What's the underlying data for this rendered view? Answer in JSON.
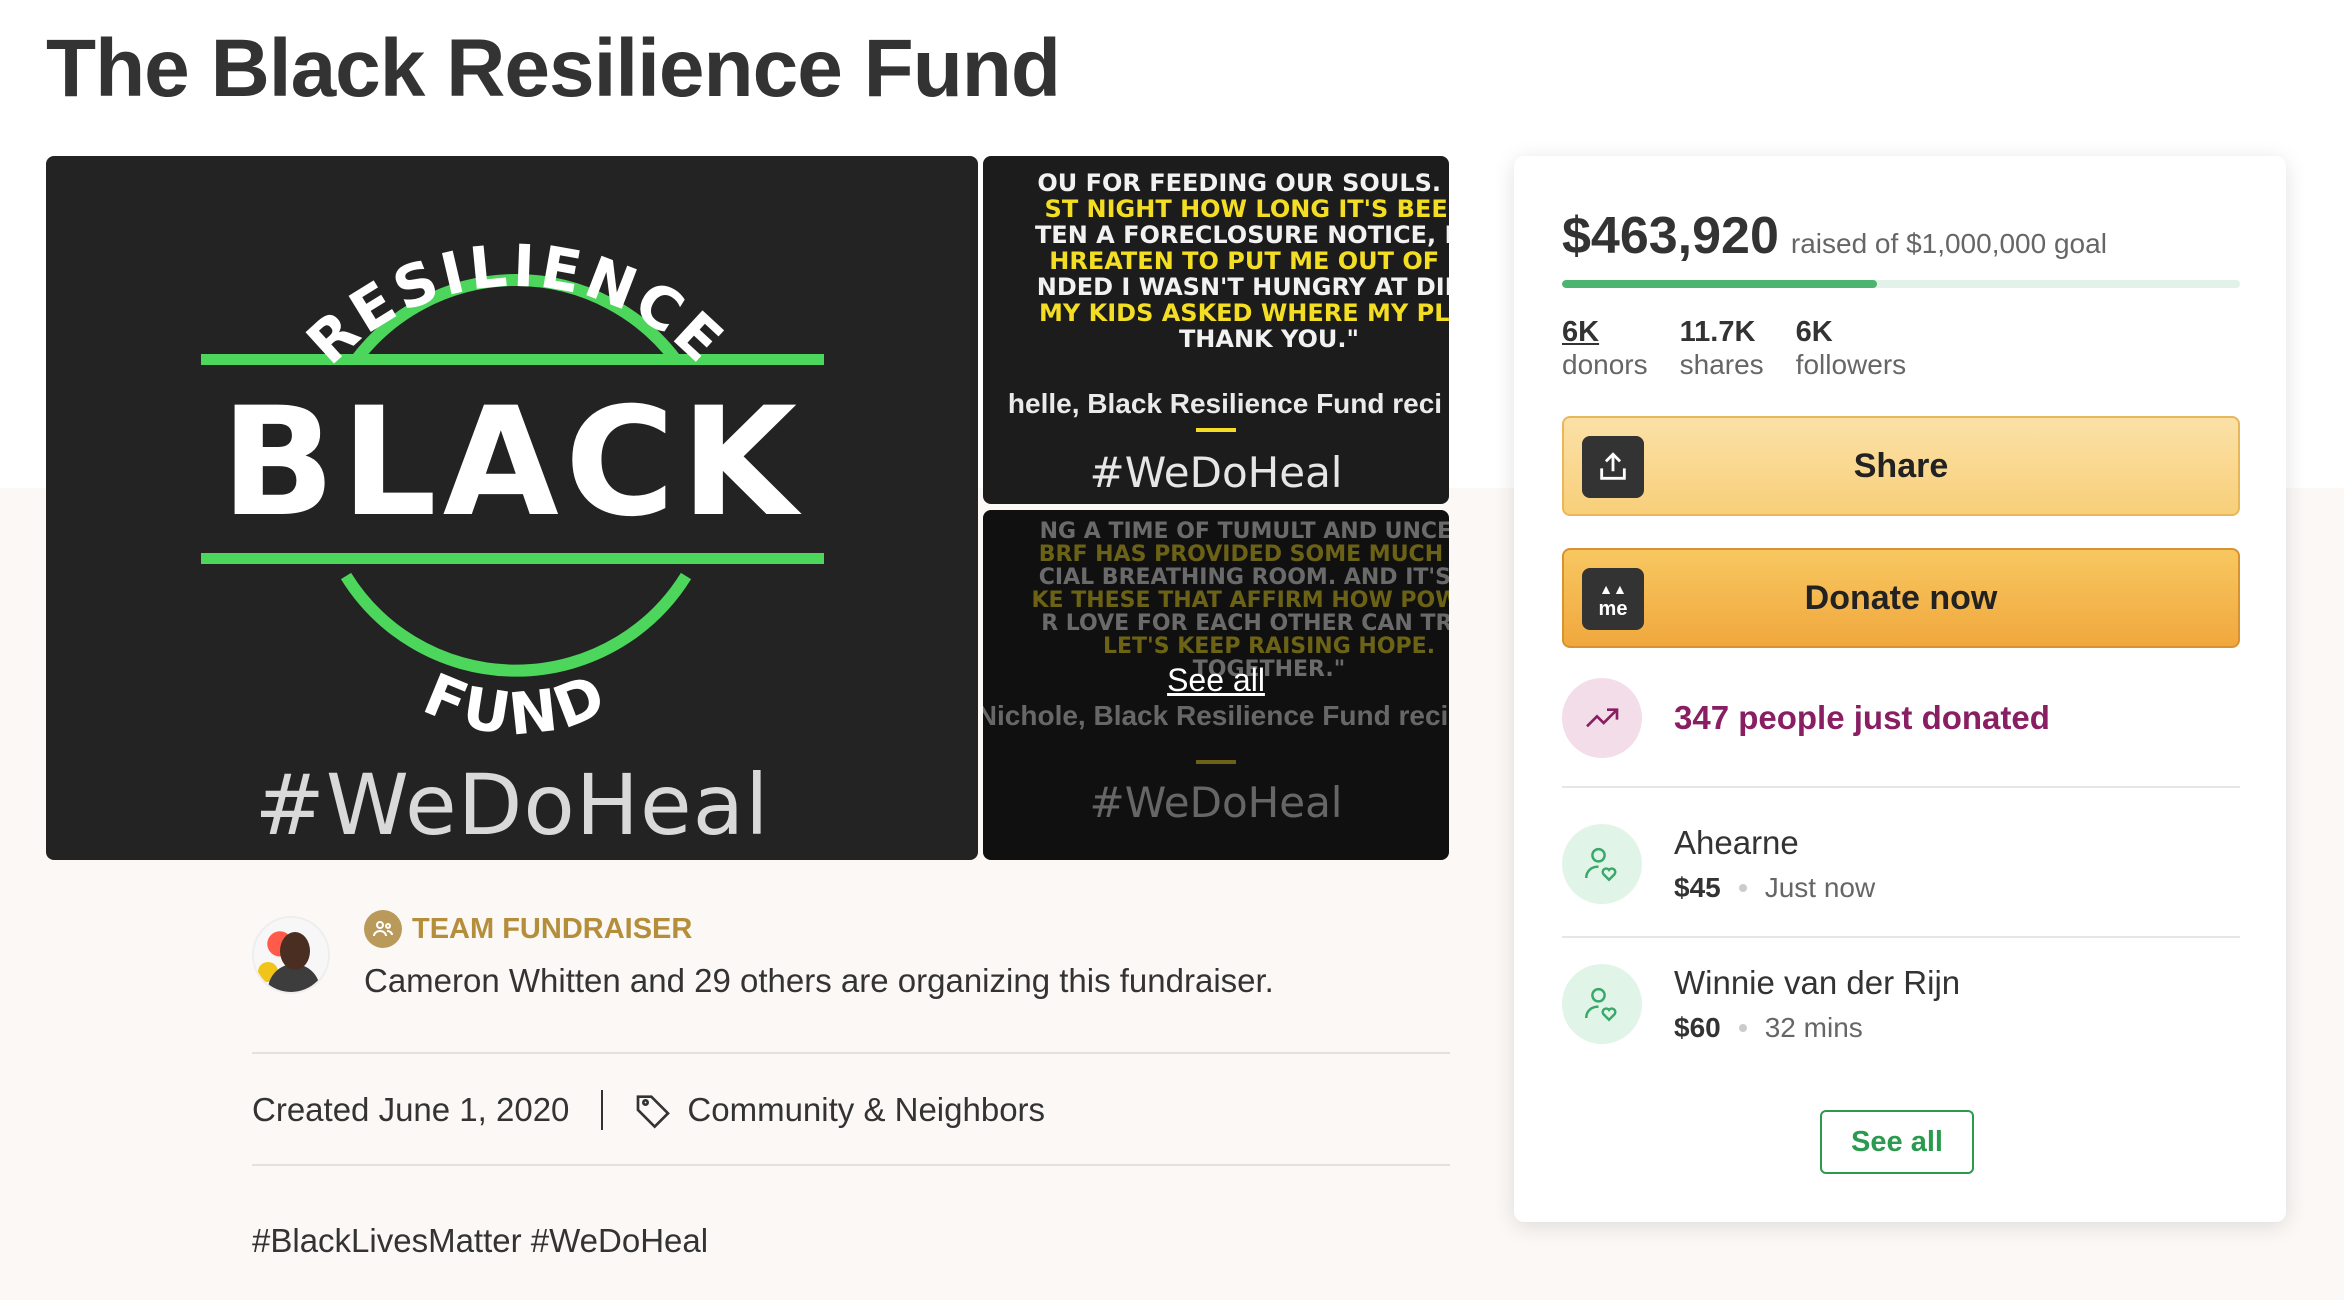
{
  "page": {
    "title": "The Black Resilience Fund"
  },
  "gallery": {
    "main_image": {
      "logo_top": "RESILIENCE",
      "logo_center": "BLACK",
      "logo_bottom": "FUND",
      "hashtag": "#WeDoHeal"
    },
    "thumb1": {
      "lines": [
        {
          "text": "OU FOR FEEDING OUR SOULS. IT C",
          "color": "white"
        },
        {
          "text": "ST NIGHT HOW LONG IT'S BEEN S",
          "color": "yellow"
        },
        {
          "text": "TEN A FORECLOSURE NOTICE, HAD",
          "color": "white"
        },
        {
          "text": "HREATEN TO PUT ME OUT OF MY",
          "color": "yellow"
        },
        {
          "text": "NDED I WASN'T HUNGRY AT DINNE",
          "color": "white"
        },
        {
          "text": "MY KIDS ASKED WHERE MY PLATE",
          "color": "yellow"
        },
        {
          "text": "THANK YOU.\"",
          "color": "white"
        }
      ],
      "attribution": "helle, Black Resilience Fund reci",
      "hashtag": "#WeDoHeal"
    },
    "thumb2": {
      "lines": [
        {
          "text": "NG A TIME OF TUMULT AND UNCERTA",
          "color": "white"
        },
        {
          "text": "BRF HAS PROVIDED SOME MUCH NEE",
          "color": "yellow"
        },
        {
          "text": "CIAL BREATHING ROOM. AND IT'S MO",
          "color": "white"
        },
        {
          "text": "KE THESE THAT AFFIRM HOW POWERF",
          "color": "yellow"
        },
        {
          "text": "R LOVE FOR EACH OTHER CAN TRULY",
          "color": "white"
        },
        {
          "text": "LET'S KEEP RAISING HOPE.",
          "color": "yellow"
        },
        {
          "text": "TOGETHER.\"",
          "color": "white"
        }
      ],
      "attribution": "Nichole, Black Resilience Fund recipi",
      "hashtag": "#WeDoHeal",
      "see_all_label": "See all"
    }
  },
  "organizer": {
    "badge_label": "TEAM FUNDRAISER",
    "text": "Cameron Whitten and 29 others are organizing this fundraiser.",
    "created": "Created June 1, 2020",
    "category": "Community & Neighbors",
    "hashtags": "#BlackLivesMatter #WeDoHeal"
  },
  "donation_card": {
    "raised_amount": "$463,920",
    "goal_text": "raised of $1,000,000 goal",
    "progress_fraction": 0.464,
    "stats": [
      {
        "value": "6K",
        "label": "donors",
        "underline": true
      },
      {
        "value": "11.7K",
        "label": "shares",
        "underline": false
      },
      {
        "value": "6K",
        "label": "followers",
        "underline": false
      }
    ],
    "share_label": "Share",
    "donate_label": "Donate now",
    "donate_icon_text": "me",
    "just_donated": "347 people just donated",
    "donors": [
      {
        "name": "Ahearne",
        "amount": "$45",
        "time": "Just now"
      },
      {
        "name": "Winnie van der Rijn",
        "amount": "$60",
        "time": "32 mins"
      }
    ],
    "see_all_label": "See all"
  },
  "colors": {
    "progress": "#4cb46e",
    "just_donated": "#8a1e63",
    "see_all_green": "#2a9a4f",
    "logo_green": "#4cd65c",
    "quote_yellow": "#f4de24",
    "team_badge": "#b48e3a"
  },
  "icons": {
    "share": "upload-icon",
    "donate": "gofundme-icon",
    "trending": "trending-up-icon",
    "donor": "user-heart-icon",
    "category": "tag-icon",
    "team": "team-icon"
  }
}
